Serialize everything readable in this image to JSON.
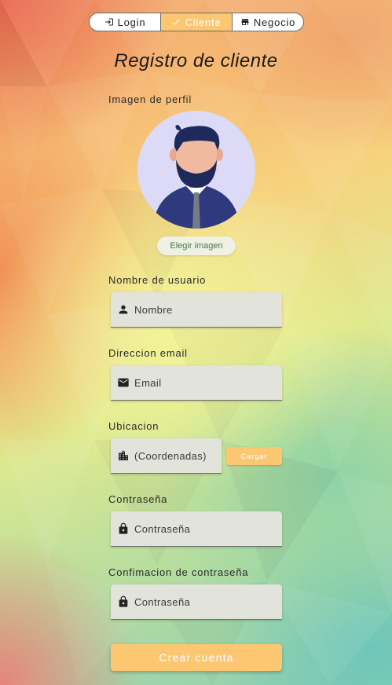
{
  "tabs": [
    {
      "label": "Login",
      "icon": "login-icon",
      "active": false
    },
    {
      "label": "Cliente",
      "icon": "check-icon",
      "active": true
    },
    {
      "label": "Negocio",
      "icon": "store-icon",
      "active": false
    }
  ],
  "page_title": "Registro de cliente",
  "profile": {
    "label": "Imagen de perfil",
    "pick_button": "Elegir imagen"
  },
  "username": {
    "label": "Nombre de usuario",
    "placeholder": "Nombre",
    "icon": "person-icon"
  },
  "email": {
    "label": "Direccion email",
    "placeholder": "Email",
    "icon": "mail-icon"
  },
  "location": {
    "label": "Ubicacion",
    "placeholder": "(Coordenadas)",
    "icon": "city-icon",
    "load_button": "Cargar"
  },
  "password": {
    "label": "Contraseña",
    "placeholder": "Contraseña",
    "icon": "lock-icon"
  },
  "password_confirm": {
    "label": "Confimacion de contraseña",
    "placeholder": "Contraseña",
    "icon": "lock-icon"
  },
  "submit_button": "Crear cuenta",
  "colors": {
    "accent": "#fdc772",
    "field_bg": "#e2e3da",
    "avatar_bg": "#dcdaf6"
  }
}
